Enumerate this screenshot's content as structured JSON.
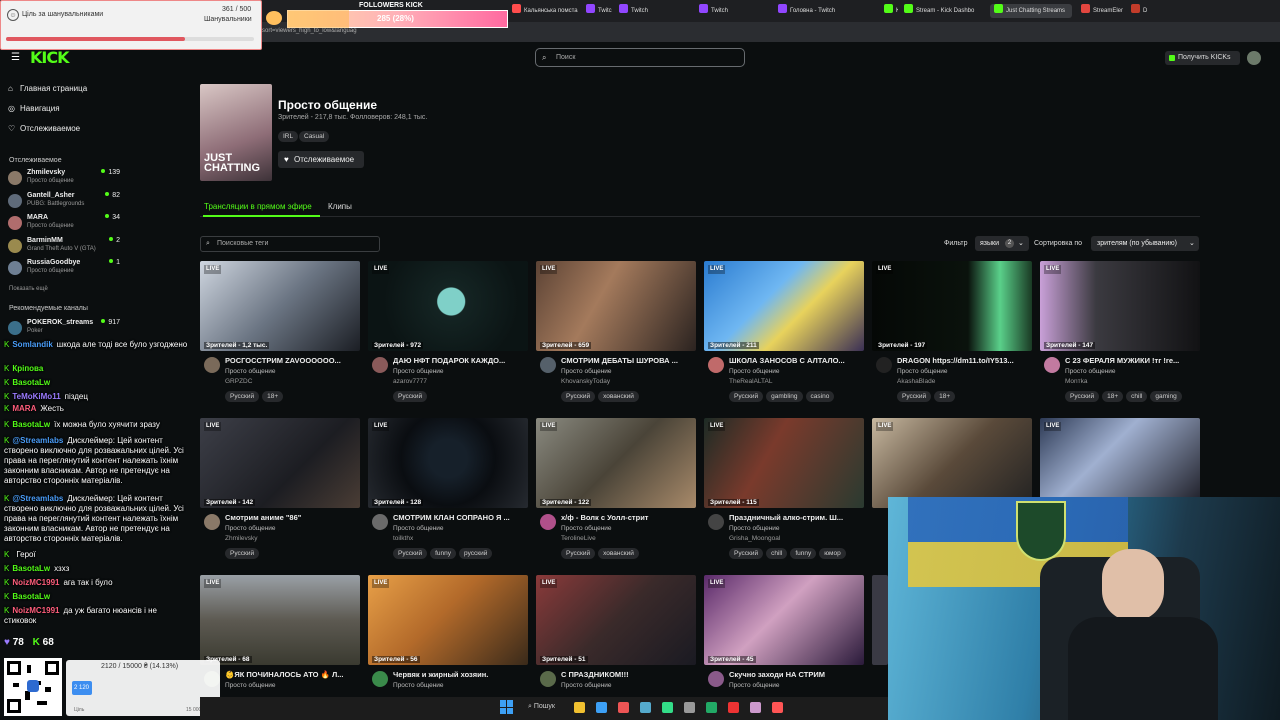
{
  "browser": {
    "tabs": [
      {
        "label": "Кальянська помста Уз",
        "color": "#ff4d4d"
      },
      {
        "label": "TwitchTV",
        "color": "#9146ff"
      },
      {
        "label": "Twitch",
        "color": "#9146ff"
      },
      {
        "label": "Twitch",
        "color": "#9146ff"
      },
      {
        "label": "Головна - Twitch",
        "color": "#9146ff"
      },
      {
        "label": "KICK",
        "color": "#53fc18"
      },
      {
        "label": "Stream - Kick Dashbo",
        "color": "#53fc18"
      },
      {
        "label": "Just Chatting Streams",
        "color": "#53fc18"
      },
      {
        "label": "StreamElements",
        "color": "#e2463f"
      },
      {
        "label": "Dota2",
        "color": "#c23c2a"
      }
    ],
    "url_fragment": "sort=viewers_high_to_low&languag"
  },
  "overlays": {
    "goal": {
      "label": "Ціль за шанувальниками",
      "current": "361 / 500",
      "sub": "Шанувальники",
      "progress": 0.72
    },
    "followers": {
      "title": "FOLLOWERS KICK",
      "text": "285 (28%)",
      "progress": 0.28
    },
    "stats": {
      "likes": "78",
      "kick": "68"
    },
    "donation": {
      "line": "2120 / 15000 ₴ (14.13%)",
      "box": "2 120",
      "left": "Ціль",
      "right": "15 000 ₴"
    }
  },
  "header": {
    "logo": "KICK",
    "search_placeholder": "Поиск",
    "get_kicks": "Получить KICKs"
  },
  "sidebar": {
    "nav": [
      "Главная страница",
      "Навигация",
      "Отслеживаемое"
    ],
    "following_title": "Отслеживаемое",
    "following": [
      {
        "name": "Zhmilevsky",
        "cat": "Просто общение",
        "viewers": "139",
        "color": "#8a7968"
      },
      {
        "name": "Gantell_Asher",
        "cat": "PUBG: Battlegrounds",
        "viewers": "82",
        "color": "#5f6b7a"
      },
      {
        "name": "MARA",
        "cat": "Просто общение",
        "viewers": "34",
        "color": "#b06d6d"
      },
      {
        "name": "BarminMM",
        "cat": "Grand Theft Auto V (GTA)",
        "viewers": "2",
        "color": "#9a8a4e"
      },
      {
        "name": "RussiaGoodbye",
        "cat": "Просто общение",
        "viewers": "1",
        "color": "#6e7f93"
      }
    ],
    "show_more": "Показать ещё",
    "recommended_title": "Рекомендуемые каналы",
    "recommended": [
      {
        "name": "POKEROK_streams",
        "cat": "Poker",
        "viewers": "917",
        "color": "#3b6f8a"
      }
    ]
  },
  "category": {
    "title": "Просто общение",
    "image_text": "JUST CHATTING",
    "stats": "Зрителей - 217,8 тыс.  Фолловеров: 248,1 тыс.",
    "tags": [
      "IRL",
      "Casual"
    ],
    "follow_label": "Отслеживаемое",
    "tabs": {
      "live": "Трансляции в прямом эфире",
      "clips": "Клипы"
    },
    "tag_search_placeholder": "Поисковые теги",
    "filter_label": "Фильтр",
    "lang_button": "языки",
    "lang_count": "2",
    "sort_label": "Сортировка по",
    "sort_value": "зрителям (по убыванию)"
  },
  "streams": [
    {
      "title": "РОСГОССТРИМ ZAVOOOOOO...",
      "cat": "Просто общение",
      "user": "GRPZDC",
      "viewers": "Зрителей - 1,2 тыс.",
      "tags": [
        "Русский",
        "18+"
      ],
      "bg": "linear-gradient(135deg,#cfd6e0,#6b7583 50%,#1b1e24)",
      "av": "#7a6a5a"
    },
    {
      "title": "ДАЮ НФТ ПОДАРОК КАЖДО...",
      "cat": "Просто общение",
      "user": "azarov7777",
      "viewers": "Зрителей - 972",
      "tags": [
        "Русский"
      ],
      "bg": "radial-gradient(circle at 52% 45%,#7fd0c8 0 14%,#142423 15%,#0b1414 70%)",
      "av": "#8a5a5a"
    },
    {
      "title": "СМОТРИМ ДЕБАТЫ ШУРОВА ...",
      "cat": "Просто общение",
      "user": "KhovanskyToday",
      "viewers": "Зрителей - 659",
      "tags": [
        "Русский",
        "хованский"
      ],
      "bg": "linear-gradient(120deg,#5c4335,#a47a5c 40%,#2b2320)",
      "av": "#55606a"
    },
    {
      "title": "ШКОЛА ЗАНОСОВ С АЛТАЛО...",
      "cat": "Просто общение",
      "user": "TheRealALTAL",
      "viewers": "Зрителей - 211",
      "tags": [
        "Русский",
        "gambling",
        "casino"
      ],
      "bg": "linear-gradient(135deg,#2a7bd0,#6fb7f2 40%,#e8d25c 60%,#3a2f55)",
      "av": "#c06a6a"
    },
    {
      "title": "DRAGON https://dm11.to/IY513...",
      "cat": "Просто общение",
      "user": "AkashaBlade",
      "viewers": "Зрителей - 197",
      "tags": [
        "Русский",
        "18+"
      ],
      "bg": "linear-gradient(90deg,#050806,#0a120c 60%,#5ad08a 80%,#1a3a24)",
      "av": "#222"
    },
    {
      "title": "С 23 ФЕРАЛЯ МУЖИКИ !тг !re...",
      "cat": "Просто общение",
      "user": "Monтka",
      "viewers": "Зрителей - 147",
      "tags": [
        "Русский",
        "18+",
        "chill",
        "gaming"
      ],
      "bg": "linear-gradient(90deg,#c9a0d8,#3b3a40 35%,#121214)",
      "av": "#c27aa0"
    },
    {
      "title": "Смотрим аниме \"86\"",
      "cat": "Просто общение",
      "user": "Zhmilevsky",
      "viewers": "Зрителей - 142",
      "tags": [
        "Русский"
      ],
      "bg": "linear-gradient(135deg,#3d3f48,#1c1d22 60%,#4a3d35)",
      "av": "#8a7968"
    },
    {
      "title": "СМОТРИМ КЛАН СОПРАНО Я ...",
      "cat": "Просто общение",
      "user": "toilkthx",
      "viewers": "Зрителей - 128",
      "tags": [
        "Русский",
        "funny",
        "русский"
      ],
      "bg": "radial-gradient(circle at 50% 45%,#16202a 0 20%,#0a0d11 50%,#262a30)",
      "av": "#6a6a6a"
    },
    {
      "title": "х/ф - Волк с Уолл-стрит",
      "cat": "Просто общение",
      "user": "TerolineLive",
      "viewers": "Зрителей - 122",
      "tags": [
        "Русский",
        "хованский"
      ],
      "bg": "linear-gradient(135deg,#8a8a80,#4a4438 50%,#a88a6a)",
      "av": "#b0508a"
    },
    {
      "title": "Праздничный алко-стрим. Ш...",
      "cat": "Просто общение",
      "user": "Grisha_Moongoal",
      "viewers": "Зрителей - 115",
      "tags": [
        "Русский",
        "chill",
        "funny",
        "юмор"
      ],
      "bg": "linear-gradient(120deg,#1d2b25,#7a3a2c 40%,#2a3a30)",
      "av": "#444"
    },
    {
      "title": "",
      "cat": "",
      "user": "",
      "viewers": "",
      "tags": [],
      "bg": "linear-gradient(135deg,#c7b8a0,#5a4a3a 50%,#222)",
      "av": "#555"
    },
    {
      "title": "",
      "cat": "",
      "user": "",
      "viewers": "",
      "tags": [],
      "bg": "linear-gradient(135deg,#2d3a55,#a0b0d0 40%,#1a1a22)",
      "av": "#555"
    },
    {
      "title": "👶ЯК ПОЧИНАЛОСЬ АТО 🔥 Л...",
      "cat": "Просто общение",
      "user": "",
      "viewers": "Зрителей - 68",
      "tags": [],
      "bg": "linear-gradient(180deg,#9aa0a6,#5d5a52 50%,#3a3a30)",
      "av": "#6a7a5a"
    },
    {
      "title": "Червяк и жирный хозяин.",
      "cat": "Просто общение",
      "user": "",
      "viewers": "Зрителей - 56",
      "tags": [],
      "bg": "linear-gradient(135deg,#e8a048,#b36a2a 45%,#3a2a1a)",
      "av": "#3a8a4a"
    },
    {
      "title": "С ПРАЗДНИКОМ!!!",
      "cat": "Просто общение",
      "user": "",
      "viewers": "Зрителей - 51",
      "tags": [],
      "bg": "linear-gradient(135deg,#8a3a3a,#3a2a2a 50%,#1a1a22)",
      "av": "#5a6a4a"
    },
    {
      "title": "Скучно заходи НА СТРИМ",
      "cat": "Просто общение",
      "user": "",
      "viewers": "Зрителей - 45",
      "tags": [],
      "bg": "linear-gradient(135deg,#5a2a6a,#d0a0c0 45%,#2a1a3a)",
      "av": "#8a5a8a"
    }
  ],
  "chat": [
    {
      "user": "Somlandik",
      "text": "шкода але тоді все було узгоджено",
      "cls": "u4"
    },
    {
      "user": "Кріпова",
      "text": "",
      "cls": "u"
    },
    {
      "user": "BasotaLw",
      "text": "",
      "cls": "u"
    },
    {
      "user": "TeMoKiMo11",
      "text": "піздец",
      "cls": "u3"
    },
    {
      "user": "MARA",
      "text": "Жесть",
      "cls": "u2"
    },
    {
      "user": "BasotaLw",
      "text": "їх можна було хуячити зразу",
      "cls": "u"
    },
    {
      "user": "@Streamlabs",
      "text": "Дисклеймер: Цей контент створено виключно для розважальних цілей. Усі права на переглянутий контент належать їхнім законним власникам. Автор не претендує на авторство сторонніх матеріалів.",
      "cls": "u4"
    },
    {
      "user": "@Streamlabs",
      "text": "Дисклеймер: Цей контент створено виключно для розважальних цілей. Усі права на переглянутий контент належать їхнім законним власникам. Автор не претендує на авторство сторонніх матеріалів.",
      "cls": "u4"
    },
    {
      "user": "",
      "text": "Герої",
      "cls": "u"
    },
    {
      "user": "BasotaLw",
      "text": "хзхз",
      "cls": "u"
    },
    {
      "user": "NoizMC1991",
      "text": "ага так і було",
      "cls": "u2"
    },
    {
      "user": "BasotaLw",
      "text": "",
      "cls": "u"
    },
    {
      "user": "NoizMC1991",
      "text": "да уж багато нюансів і не стиковок",
      "cls": "u2"
    }
  ],
  "taskbar": {
    "search": "Пошук"
  }
}
